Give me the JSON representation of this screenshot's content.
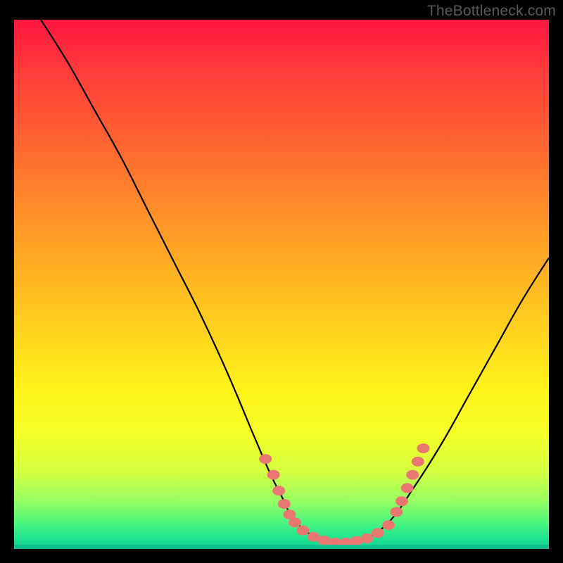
{
  "watermark": "TheBottleneck.com",
  "colors": {
    "dot": "#ea776f",
    "curve": "#000000"
  },
  "chart_data": {
    "type": "line",
    "title": "",
    "xlabel": "",
    "ylabel": "",
    "xlim": [
      0,
      100
    ],
    "ylim": [
      0,
      100
    ],
    "grid": false,
    "legend": false,
    "series": [
      {
        "name": "bottleneck-curve",
        "x": [
          5,
          10,
          15,
          20,
          25,
          30,
          35,
          40,
          45,
          48,
          50,
          52,
          55,
          58,
          60,
          62,
          65,
          70,
          75,
          80,
          85,
          90,
          95,
          100
        ],
        "y": [
          100,
          92,
          83,
          74,
          64,
          54,
          44,
          33,
          21,
          14,
          10,
          6,
          3,
          1.5,
          1,
          1,
          1.5,
          5,
          12,
          20,
          29,
          38,
          47,
          55
        ]
      }
    ],
    "highlight_points": {
      "name": "salmon-dots",
      "x": [
        47,
        48.5,
        49.5,
        50.5,
        51.5,
        52.5,
        54,
        56,
        58,
        60,
        62,
        64,
        66,
        68,
        70,
        71.5,
        72.5,
        73.5,
        74.5,
        75.5,
        76.5
      ],
      "y": [
        17,
        14,
        11,
        8.5,
        6.5,
        5,
        3.5,
        2.3,
        1.6,
        1.2,
        1.2,
        1.5,
        2,
        3,
        4.5,
        7,
        9,
        11.5,
        14,
        16.5,
        19
      ]
    }
  }
}
